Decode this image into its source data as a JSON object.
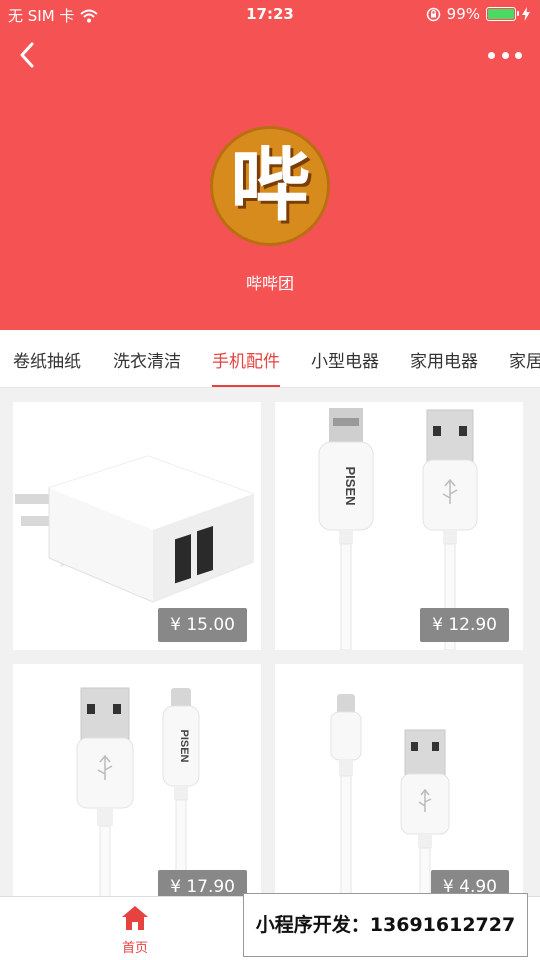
{
  "status_bar": {
    "carrier": "无 SIM 卡",
    "time": "17:23",
    "battery_percent": "99%",
    "battery_level": 0.99
  },
  "header": {
    "logo_char": "哔",
    "store_name": "哔哔团",
    "background_color": "#f55353"
  },
  "tabs": [
    {
      "label": "卷纸抽纸",
      "active": false
    },
    {
      "label": "洗衣清洁",
      "active": false
    },
    {
      "label": "手机配件",
      "active": true
    },
    {
      "label": "小型电器",
      "active": false
    },
    {
      "label": "家用电器",
      "active": false
    },
    {
      "label": "家居",
      "active": false
    }
  ],
  "products": [
    {
      "price": "¥ 15.00",
      "image": "usb-wall-charger"
    },
    {
      "price": "¥ 12.90",
      "image": "pisen-micro-usb-cable"
    },
    {
      "price": "¥ 17.90",
      "image": "pisen-lightning-cable"
    },
    {
      "price": "¥ 4.90",
      "image": "lightning-cable"
    }
  ],
  "tabbar": {
    "home_label": "首页",
    "accent_color": "#e64340"
  },
  "promo": {
    "text": "小程序开发：13691612727"
  }
}
